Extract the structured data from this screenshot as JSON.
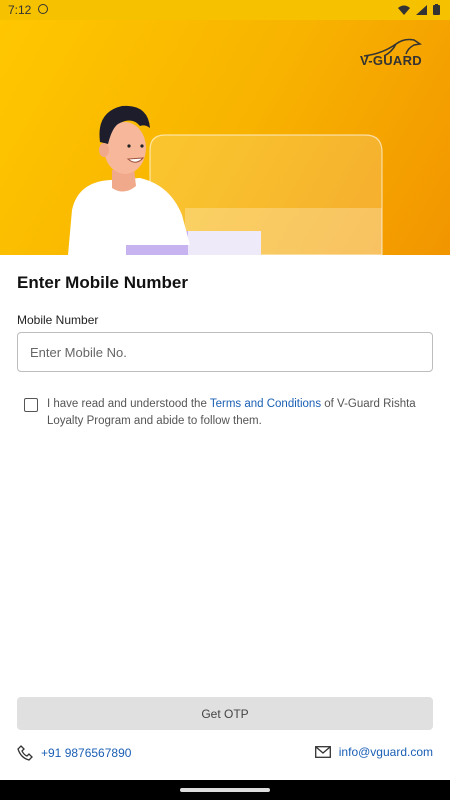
{
  "status_bar": {
    "time": "7:12"
  },
  "brand": {
    "logo_text": "V-GUARD"
  },
  "form": {
    "heading": "Enter Mobile Number",
    "field_label": "Mobile Number",
    "mobile_placeholder": "Enter Mobile No.",
    "mobile_value": "",
    "terms_checked": false,
    "terms_prefix": "I have read and understood the ",
    "terms_link": "Terms and Conditions",
    "terms_suffix": "  of V-Guard Rishta Loyalty Program and abide to follow them.",
    "get_otp_label": "Get OTP"
  },
  "footer": {
    "phone": "+91 9876567890",
    "email": "info@vguard.com"
  },
  "colors": {
    "hero_start": "#ffc700",
    "hero_end": "#f29500",
    "link": "#1a5fb4",
    "button_disabled": "#e0e0e0"
  }
}
